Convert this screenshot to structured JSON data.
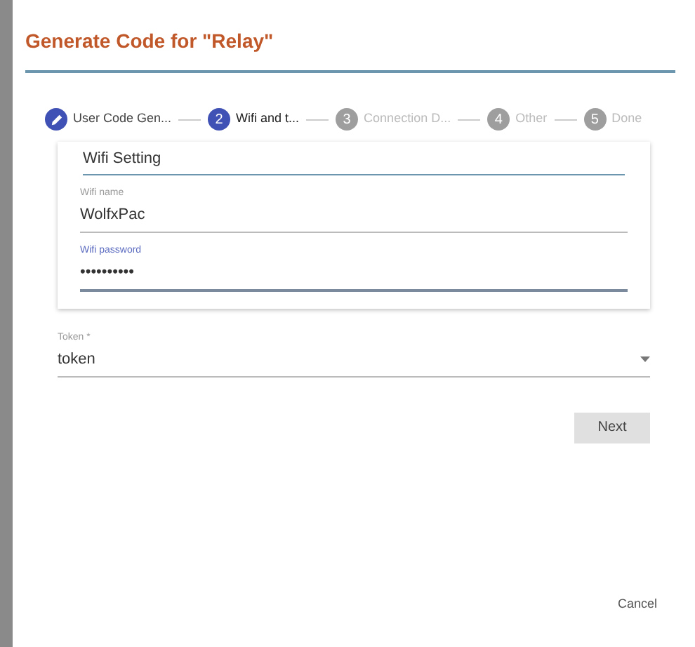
{
  "dialog": {
    "title": "Generate Code for \"Relay\""
  },
  "steps": [
    {
      "label": "User Code Gen...",
      "completed": true,
      "selected": false
    },
    {
      "number": "2",
      "label": "Wifi and t...",
      "completed": false,
      "selected": true
    },
    {
      "number": "3",
      "label": "Connection D...",
      "completed": false,
      "selected": false
    },
    {
      "number": "4",
      "label": "Other",
      "completed": false,
      "selected": false
    },
    {
      "number": "5",
      "label": "Done",
      "completed": false,
      "selected": false
    }
  ],
  "wifi_card": {
    "heading": "Wifi Setting",
    "fields": [
      {
        "label": "Wifi name",
        "value": "WolfxPac",
        "focused": false
      },
      {
        "label": "Wifi password",
        "value": "••••••••••",
        "focused": true
      }
    ]
  },
  "token": {
    "label": "Token *",
    "value": "token"
  },
  "buttons": {
    "next": "Next",
    "cancel": "Cancel"
  }
}
